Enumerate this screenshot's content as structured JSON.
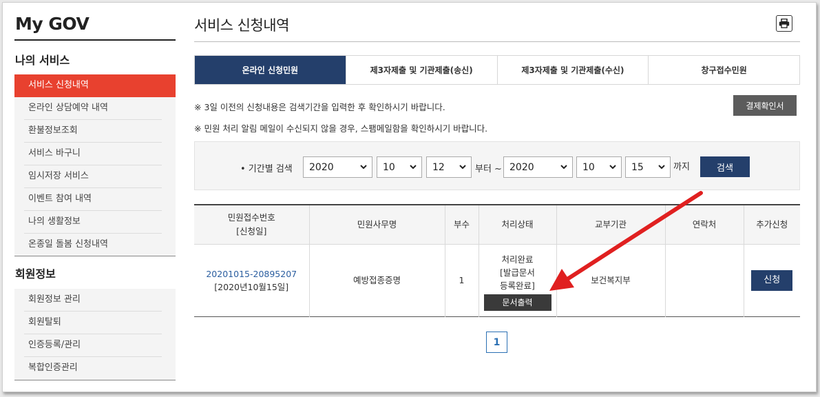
{
  "sidebar": {
    "brand": "My GOV",
    "section1_title": "나의 서비스",
    "section1_items": [
      {
        "label": "서비스 신청내역",
        "active": true
      },
      {
        "label": "온라인 상담예약 내역"
      },
      {
        "label": "환불정보조회"
      },
      {
        "label": "서비스 바구니"
      },
      {
        "label": "임시저장 서비스"
      },
      {
        "label": "이벤트 참여 내역"
      },
      {
        "label": "나의 생활정보"
      },
      {
        "label": "온종일 돌봄 신청내역"
      }
    ],
    "section2_title": "회원정보",
    "section2_items": [
      {
        "label": "회원정보 관리"
      },
      {
        "label": "회원탈퇴"
      },
      {
        "label": "인증등록/관리"
      },
      {
        "label": "복합인증관리"
      }
    ]
  },
  "main": {
    "title": "서비스 신청내역",
    "print_icon": "printer-icon",
    "tabs": [
      {
        "label": "온라인 신청민원",
        "active": true
      },
      {
        "label": "제3자제출 및 기관제출(송신)"
      },
      {
        "label": "제3자제출 및 기관제출(수신)"
      },
      {
        "label": "창구접수민원"
      }
    ],
    "notice1": "※ 3일 이전의 신청내용은 검색기간을 입력한 후 확인하시기 바랍니다.",
    "notice2": "※ 민원 처리 알림 메일이 수신되지 않을 경우, 스팸메일함을 확인하시기 바랍니다.",
    "pay_confirm_button": "결제확인서",
    "search": {
      "label": "• 기간별 검색",
      "from_year": "2020",
      "from_month": "10",
      "from_day": "12",
      "from_suffix": "부터 ~",
      "to_year": "2020",
      "to_month": "10",
      "to_day": "15",
      "to_suffix": "까지",
      "button": "검색"
    },
    "table": {
      "headers": [
        "민원접수번호",
        "[신청일]",
        "민원사무명",
        "부수",
        "처리상태",
        "교부기관",
        "연락처",
        "추가신청"
      ],
      "row": {
        "receipt_no": "20201015-20895207",
        "apply_date": "[2020년10월15일]",
        "service_name": "예방접종증명",
        "copies": "1",
        "status_line1": "처리완료",
        "status_line2": "[발급문서",
        "status_line3": "등록완료]",
        "print_button": "문서출력",
        "agency": "보건복지부",
        "contact": "",
        "apply_button": "신청"
      }
    },
    "pagination": [
      "1"
    ],
    "annotation_color": "#e02020"
  }
}
